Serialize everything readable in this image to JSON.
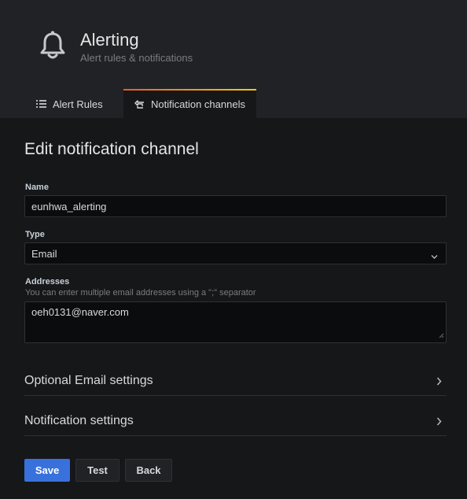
{
  "header": {
    "icon": "bell-icon",
    "title": "Alerting",
    "subtitle": "Alert rules & notifications"
  },
  "tabs": [
    {
      "label": "Alert Rules",
      "icon": "list-icon",
      "active": false
    },
    {
      "label": "Notification channels",
      "icon": "channels-icon",
      "active": true
    }
  ],
  "form": {
    "heading": "Edit notification channel",
    "name": {
      "label": "Name",
      "value": "eunhwa_alerting"
    },
    "type": {
      "label": "Type",
      "value": "Email"
    },
    "addresses": {
      "label": "Addresses",
      "description": "You can enter multiple email addresses using a \";\" separator",
      "value": "oeh0131@naver.com"
    },
    "sections": [
      {
        "label": "Optional Email settings",
        "expanded": false
      },
      {
        "label": "Notification settings",
        "expanded": false
      }
    ],
    "buttons": {
      "save": "Save",
      "test": "Test",
      "back": "Back"
    }
  },
  "colors": {
    "accent_primary": "#3871dc",
    "tab_gradient_start": "#f05a28",
    "tab_gradient_end": "#fbca0a",
    "header_bg": "#212225",
    "page_bg": "#161719"
  }
}
